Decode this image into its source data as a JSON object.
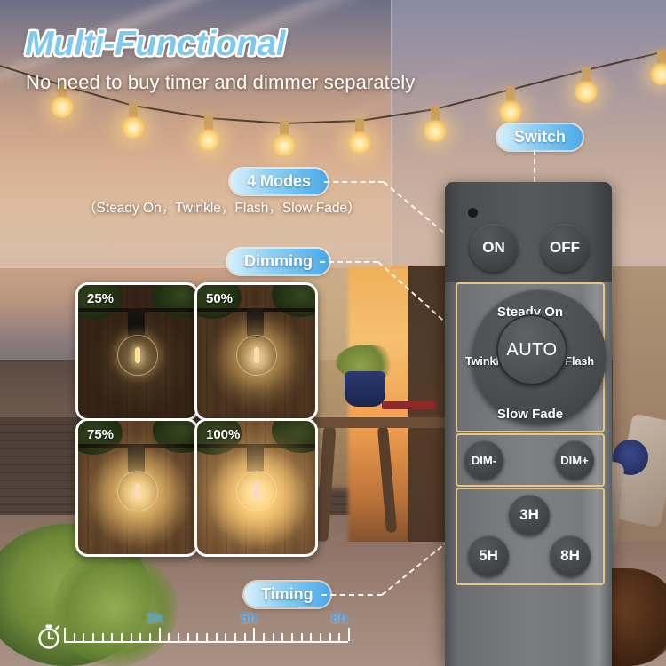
{
  "header": {
    "title": "Multi-Functional",
    "subtitle": "No need to buy timer and dimmer separately",
    "title_color": "#7ec9ec"
  },
  "badges": {
    "modes": "4 Modes",
    "dimming": "Dimming",
    "switch": "Switch",
    "timing": "Timing",
    "gradient_from": "#d9f0fb",
    "gradient_to": "#4aa9e8"
  },
  "modes_caption": "（Steady On，Twinkle，Flash，Slow Fade）",
  "dimming": {
    "tiles": [
      {
        "label": "25%"
      },
      {
        "label": "50%"
      },
      {
        "label": "75%"
      },
      {
        "label": "100%"
      }
    ]
  },
  "remote": {
    "power": {
      "on": "ON",
      "off": "OFF"
    },
    "wheel": {
      "center": "AUTO",
      "top": "Steady On",
      "left": "Twinkle",
      "right": "Flash",
      "bottom": "Slow Fade"
    },
    "dim": {
      "minus": "DIM-",
      "plus": "DIM+"
    },
    "timer": {
      "t3": "3H",
      "t5": "5H",
      "t8": "8H"
    },
    "panel_border_color": "#e8c583",
    "body_color": "#7a7d80"
  },
  "timing_scale": {
    "marks": [
      {
        "label": "3h"
      },
      {
        "label": "5h"
      },
      {
        "label": "8h"
      }
    ],
    "label_color": "#4f9fe0",
    "icon": "stopwatch-icon"
  }
}
